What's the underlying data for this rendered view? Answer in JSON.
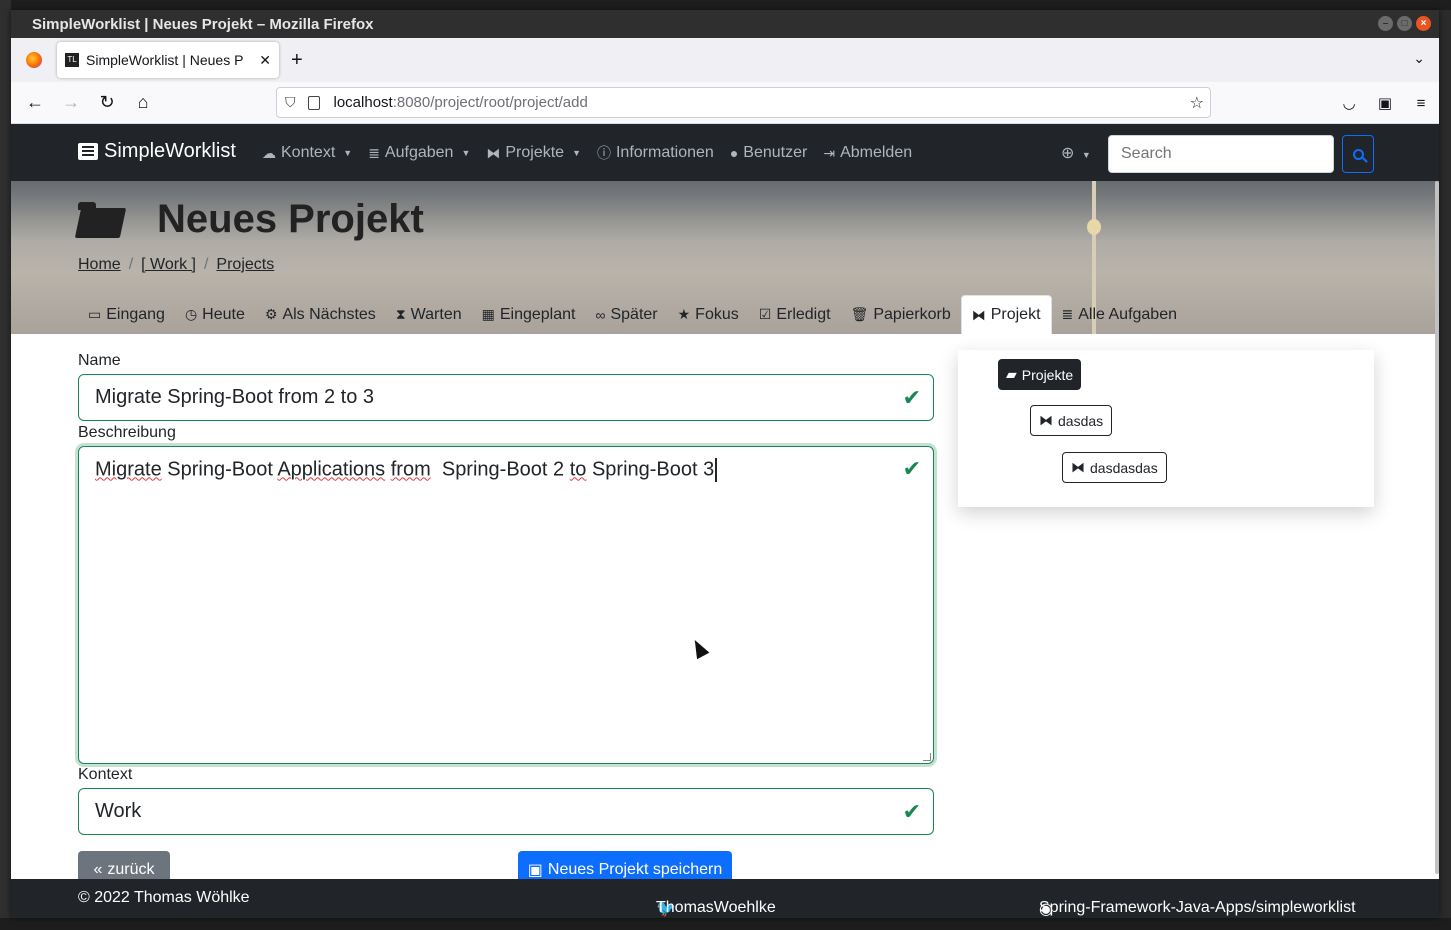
{
  "window": {
    "title": "SimpleWorklist | Neues Projekt – Mozilla Firefox",
    "tab_title": "SimpleWorklist | Neues P",
    "tab_favicon": "TL",
    "url_host": "localhost",
    "url_path": ":8080/project/root/project/add"
  },
  "navbar": {
    "brand": "SimpleWorklist",
    "items": [
      {
        "label": "Kontext",
        "icon": "cloud-icon",
        "dropdown": true
      },
      {
        "label": "Aufgaben",
        "icon": "database-icon",
        "dropdown": true
      },
      {
        "label": "Projekte",
        "icon": "project-diagram-icon",
        "dropdown": true
      },
      {
        "label": "Informationen",
        "icon": "info-circle-icon",
        "dropdown": false
      },
      {
        "label": "Benutzer",
        "icon": "user-icon",
        "dropdown": false
      },
      {
        "label": "Abmelden",
        "icon": "sign-out-icon",
        "dropdown": false
      }
    ],
    "search_placeholder": "Search"
  },
  "hero": {
    "title": "Neues Projekt",
    "breadcrumb": [
      "Home",
      "[ Work ]",
      "Projects"
    ],
    "tabs": [
      {
        "label": "Eingang",
        "icon": "inbox-icon"
      },
      {
        "label": "Heute",
        "icon": "clock-icon"
      },
      {
        "label": "Als Nächstes",
        "icon": "cogs-icon"
      },
      {
        "label": "Warten",
        "icon": "hourglass-icon"
      },
      {
        "label": "Eingeplant",
        "icon": "calendar-icon"
      },
      {
        "label": "Später",
        "icon": "binoculars-icon"
      },
      {
        "label": "Fokus",
        "icon": "star-icon"
      },
      {
        "label": "Erledigt",
        "icon": "check-square-icon"
      },
      {
        "label": "Papierkorb",
        "icon": "trash-icon"
      },
      {
        "label": "Projekt",
        "icon": "project-diagram-icon",
        "active": true
      },
      {
        "label": "Alle Aufgaben",
        "icon": "database-icon"
      }
    ]
  },
  "form": {
    "name_label": "Name",
    "name_value": "Migrate Spring-Boot from 2 to 3",
    "desc_label": "Beschreibung",
    "desc_words": [
      "Migrate",
      " Spring-Boot ",
      "Applications",
      " ",
      "from",
      "  Spring-Boot 2 ",
      "to",
      " Spring-Boot 3"
    ],
    "context_label": "Kontext",
    "context_value": "Work",
    "back_label": "zurück",
    "save_label": "Neues Projekt speichern"
  },
  "tree": {
    "root": "Projekte",
    "child": "dasdas",
    "grandchild": "dasdasdas"
  },
  "footer": {
    "copyright": "© 2022 Thomas Wöhlke",
    "twitter": "ThomasWoehlke",
    "github": "Spring-Framework-Java-Apps/simpleworklist"
  }
}
